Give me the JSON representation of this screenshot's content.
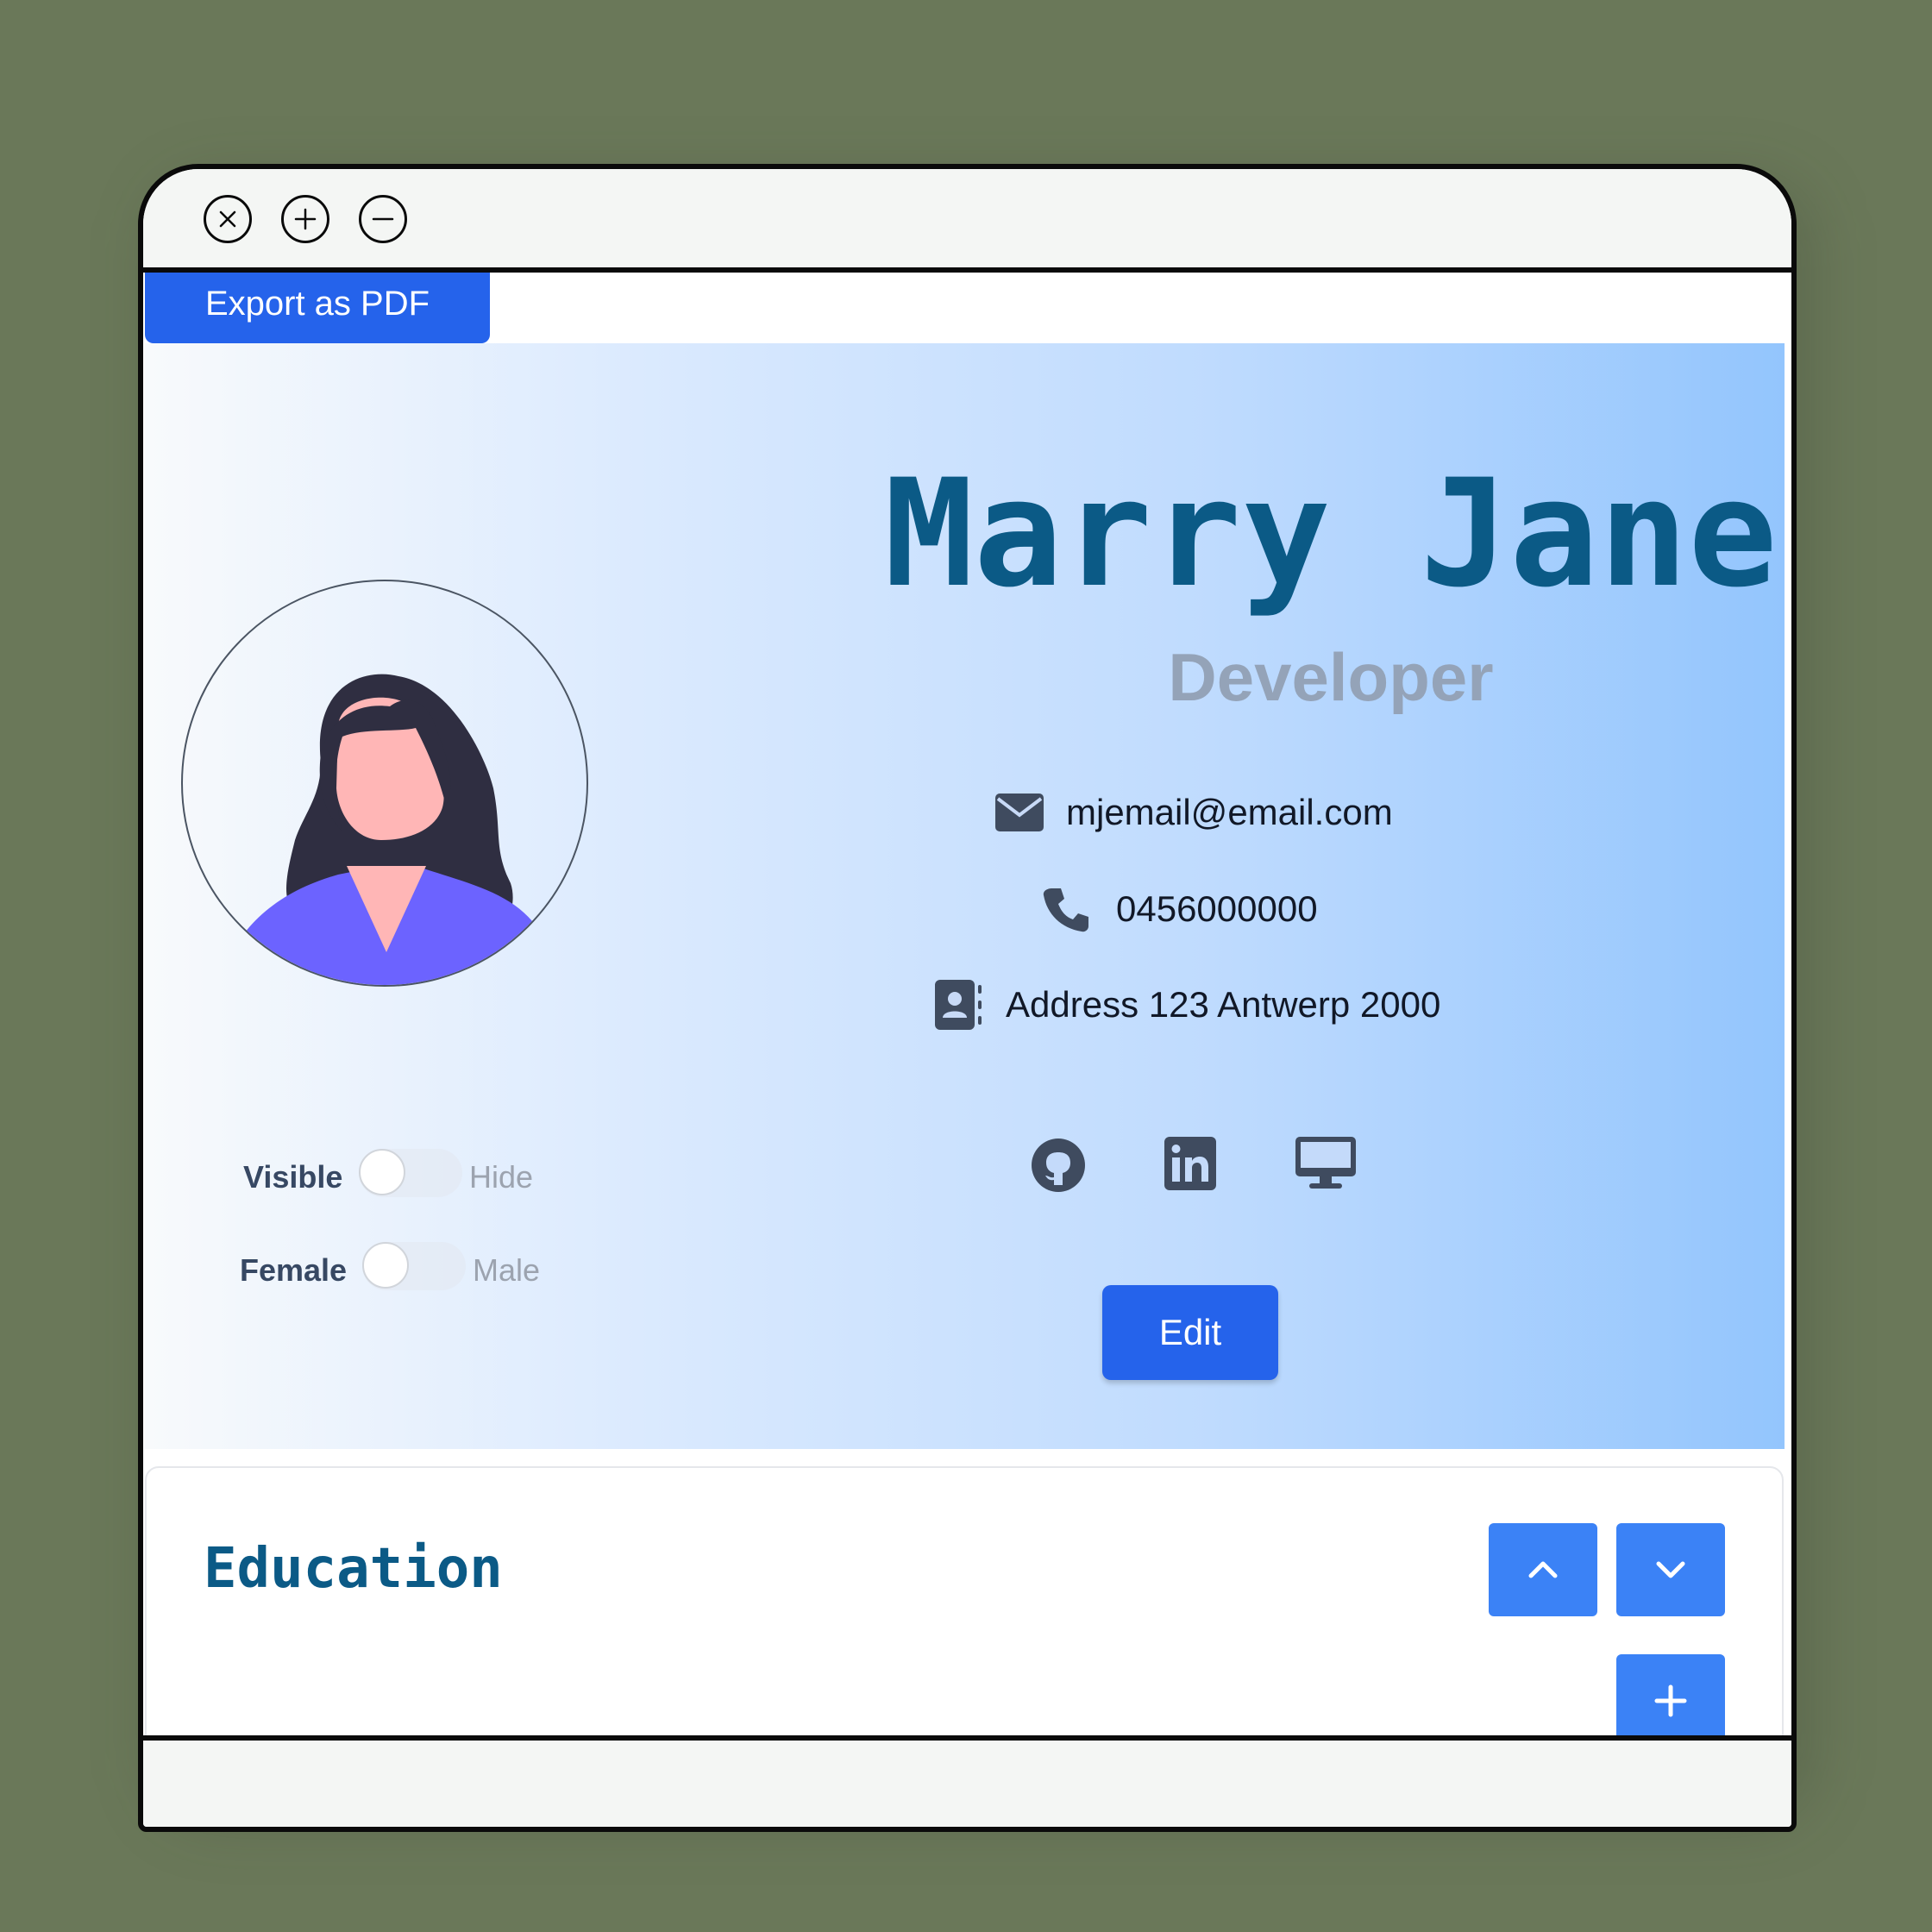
{
  "window": {
    "controls": [
      "close-icon",
      "plus-icon",
      "minus-icon"
    ]
  },
  "toolbar": {
    "export_label": "Export as PDF"
  },
  "profile": {
    "name": "Marry Jane",
    "role": "Developer",
    "email": "mjemail@email.com",
    "phone": "0456000000",
    "address": "Address 123 Antwerp 2000",
    "social_icons": [
      "github-icon",
      "linkedin-icon",
      "desktop-icon"
    ],
    "edit_label": "Edit"
  },
  "toggles": {
    "visibility": {
      "on_label": "Visible",
      "off_label": "Hide"
    },
    "gender": {
      "on_label": "Female",
      "off_label": "Male"
    }
  },
  "education": {
    "title": "Education"
  },
  "colors": {
    "accent": "#2563eb",
    "title": "#0b5a86",
    "subtle": "#94a3b8",
    "background": "#6a7859"
  }
}
